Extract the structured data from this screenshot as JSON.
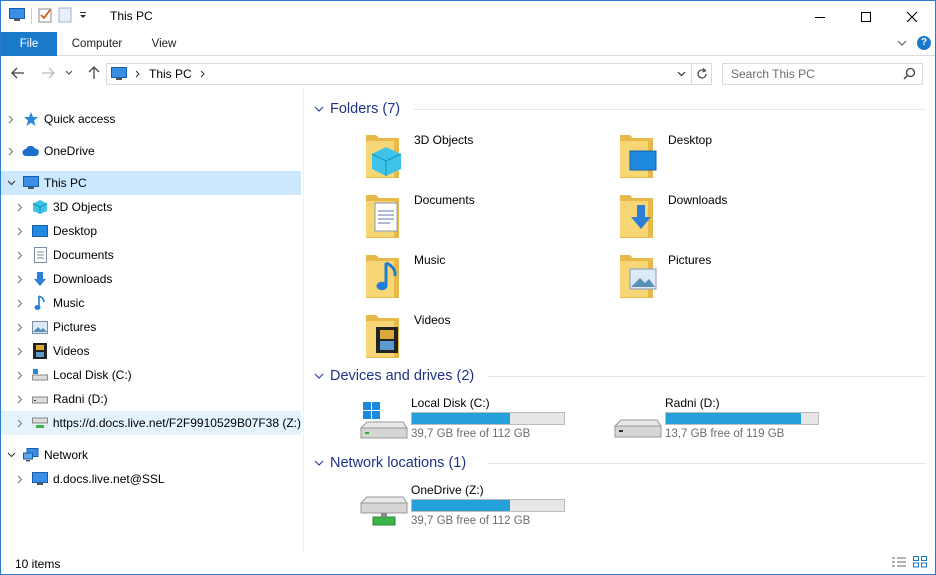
{
  "window": {
    "title": "This PC"
  },
  "ribbon": {
    "tabs": [
      "File",
      "Computer",
      "View"
    ]
  },
  "address": {
    "crumb": "This PC"
  },
  "search": {
    "placeholder": "Search This PC"
  },
  "navpane": {
    "quick_access": "Quick access",
    "onedrive": "OneDrive",
    "this_pc": "This PC",
    "children": [
      "3D Objects",
      "Desktop",
      "Documents",
      "Downloads",
      "Music",
      "Pictures",
      "Videos",
      "Local Disk (C:)",
      "Radni (D:)",
      "https://d.docs.live.net/F2F9910529B07F38 (Z:)"
    ],
    "network": "Network",
    "network_child": "d.docs.live.net@SSL"
  },
  "content": {
    "folders_header": "Folders (7)",
    "folders": [
      "3D Objects",
      "Desktop",
      "Documents",
      "Downloads",
      "Music",
      "Pictures",
      "Videos"
    ],
    "devices_header": "Devices and drives (2)",
    "drives": [
      {
        "name": "Local Disk (C:)",
        "free": "39,7 GB free of 112 GB",
        "used_fraction": 0.646
      },
      {
        "name": "Radni (D:)",
        "free": "13,7 GB free of 119 GB",
        "used_fraction": 0.885
      }
    ],
    "network_header": "Network locations (1)",
    "network_locations": [
      {
        "name": "OneDrive (Z:)",
        "free": "39,7 GB free of 112 GB",
        "used_fraction": 0.646
      }
    ]
  },
  "status": {
    "count": "10 items"
  },
  "colors": {
    "accent": "#1979ca",
    "selection": "#cce8ff",
    "header_text": "#1e3287",
    "bar_fill": "#26a0da"
  }
}
